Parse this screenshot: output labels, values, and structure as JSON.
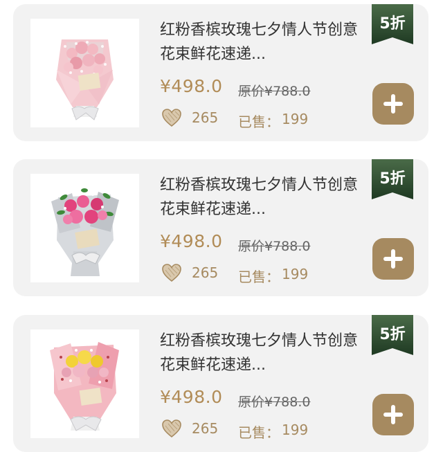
{
  "colors": {
    "card_bg": "#f2f2f2",
    "price": "#b18c57",
    "accent_brown": "#a68a60",
    "badge_green": "#2f4f2f",
    "text_dark": "#333333",
    "text_gray": "#666666"
  },
  "products": [
    {
      "title": "红粉香槟玫瑰七夕情人节创意花束鲜花速递...",
      "price": "¥498.0",
      "original_price": "原价¥788.0",
      "likes": "265",
      "sold_label": "已售：",
      "sold_count": "199",
      "discount": "5折",
      "image": "pink-rose-bouquet",
      "like_icon": "heart-icon",
      "add_icon": "plus-icon"
    },
    {
      "title": "红粉香槟玫瑰七夕情人节创意花束鲜花速递...",
      "price": "¥498.0",
      "original_price": "原价¥788.0",
      "likes": "265",
      "sold_label": "已售：",
      "sold_count": "199",
      "discount": "5折",
      "image": "hot-pink-rose-bouquet",
      "like_icon": "heart-icon",
      "add_icon": "plus-icon"
    },
    {
      "title": "红粉香槟玫瑰七夕情人节创意花束鲜花速递...",
      "price": "¥498.0",
      "original_price": "原价¥788.0",
      "likes": "265",
      "sold_label": "已售：",
      "sold_count": "199",
      "discount": "5折",
      "image": "yellow-rose-bouquet",
      "like_icon": "heart-icon",
      "add_icon": "plus-icon"
    }
  ]
}
